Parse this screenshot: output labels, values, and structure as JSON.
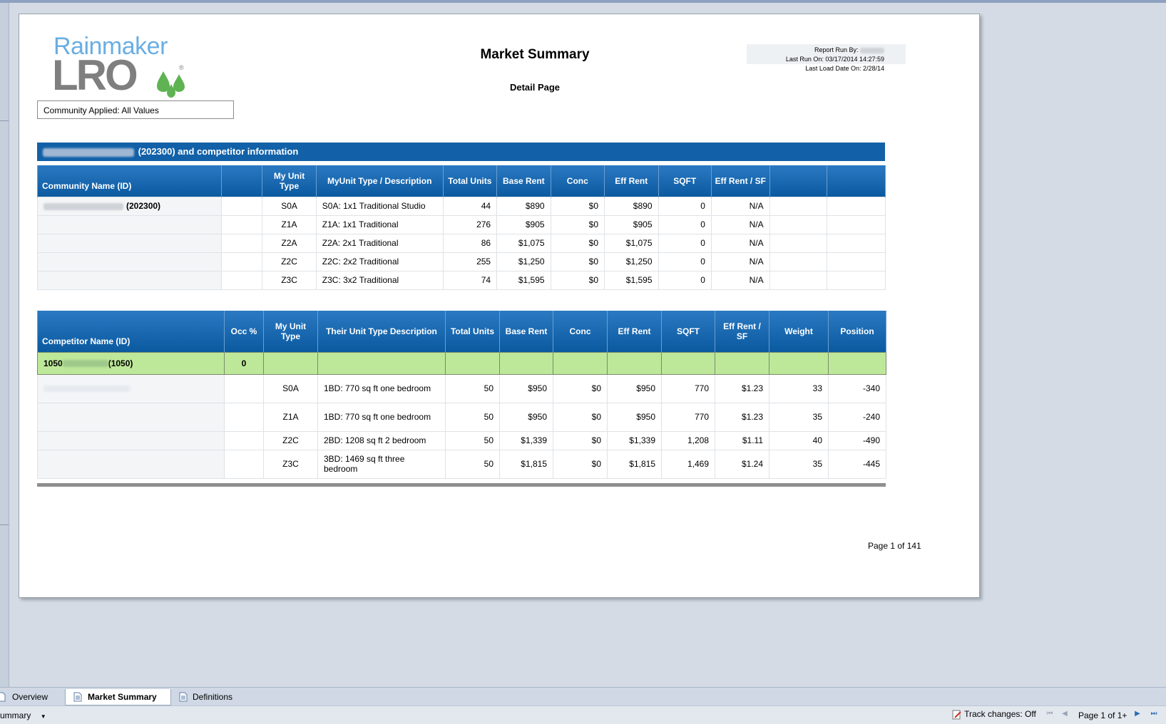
{
  "logo": {
    "text_top": "Rainmaker",
    "text_bottom": "LRO",
    "reg": "®"
  },
  "report": {
    "title": "Market Summary",
    "subtitle": "Detail Page",
    "run_by_label": "Report Run By:",
    "last_run": "Last Run On: 03/17/2014 14:27:59",
    "last_load": "Last Load Date On: 2/28/14",
    "filter": "Community Applied: All Values",
    "banner_suffix": "(202300) and competitor information",
    "page_number": "Page 1 of 141"
  },
  "community_table": {
    "headers": [
      "Community Name (ID)",
      "",
      "My Unit Type",
      "MyUnit Type / Description",
      "Total Units",
      "Base Rent",
      "Conc",
      "Eff Rent",
      "SQFT",
      "Eff Rent / SF",
      "",
      ""
    ],
    "community_id": "(202300)",
    "rows": [
      [
        "S0A",
        "S0A: 1x1 Traditional Studio",
        "44",
        "$890",
        "$0",
        "$890",
        "0",
        "N/A"
      ],
      [
        "Z1A",
        "Z1A: 1x1 Traditional",
        "276",
        "$905",
        "$0",
        "$905",
        "0",
        "N/A"
      ],
      [
        "Z2A",
        "Z2A: 2x1 Traditional",
        "86",
        "$1,075",
        "$0",
        "$1,075",
        "0",
        "N/A"
      ],
      [
        "Z2C",
        "Z2C: 2x2 Traditional",
        "255",
        "$1,250",
        "$0",
        "$1,250",
        "0",
        "N/A"
      ],
      [
        "Z3C",
        "Z3C: 3x2 Traditional",
        "74",
        "$1,595",
        "$0",
        "$1,595",
        "0",
        "N/A"
      ]
    ]
  },
  "competitor_table": {
    "headers": [
      "Competitor Name (ID)",
      "Occ %",
      "My Unit Type",
      "Their Unit Type Description",
      "Total Units",
      "Base Rent",
      "Conc",
      "Eff Rent",
      "SQFT",
      "Eff Rent / SF",
      "Weight",
      "Position"
    ],
    "group": {
      "id_prefix": "1050",
      "id_suffix": "(1050)",
      "occ": "0"
    },
    "rows": [
      [
        "S0A",
        "1BD: 770 sq ft one bedroom",
        "50",
        "$950",
        "$0",
        "$950",
        "770",
        "$1.23",
        "33",
        "-340"
      ],
      [
        "Z1A",
        "1BD: 770 sq ft one bedroom",
        "50",
        "$950",
        "$0",
        "$950",
        "770",
        "$1.23",
        "35",
        "-240"
      ],
      [
        "Z2C",
        "2BD: 1208 sq ft 2 bedroom",
        "50",
        "$1,339",
        "$0",
        "$1,339",
        "1,208",
        "$1.11",
        "40",
        "-490"
      ],
      [
        "Z3C",
        "3BD: 1469 sq ft three bedroom",
        "50",
        "$1,815",
        "$0",
        "$1,815",
        "1,469",
        "$1.24",
        "35",
        "-445"
      ]
    ]
  },
  "tabs": {
    "overview": "Overview",
    "market_summary": "Market Summary",
    "definitions": "Definitions"
  },
  "status": {
    "left": "ummary",
    "track_changes": "Track changes: Off",
    "page": "Page 1 of 1+"
  }
}
